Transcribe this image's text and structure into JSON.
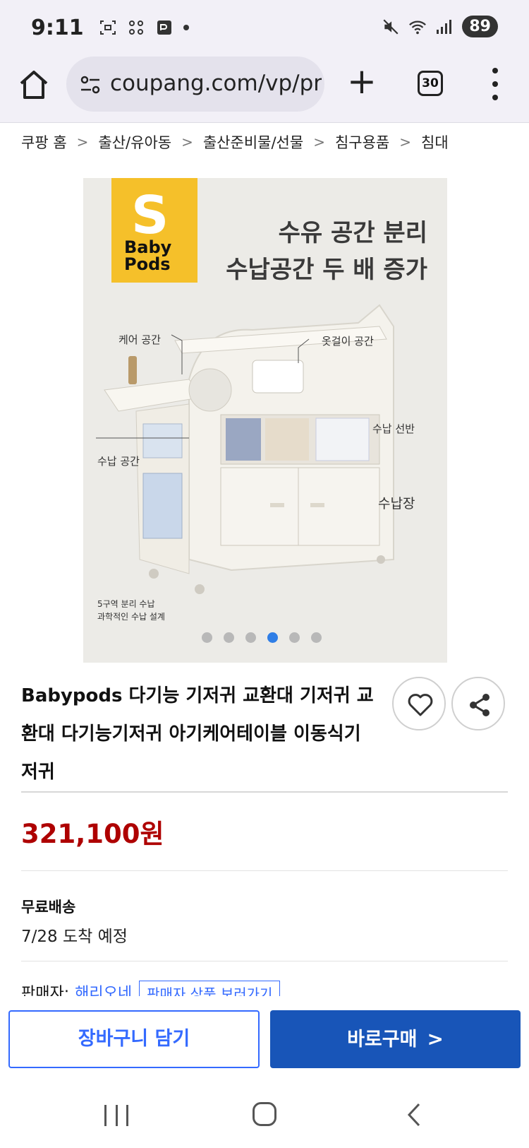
{
  "status_bar": {
    "time": "9:11",
    "battery": "89",
    "icons_left": [
      "screenshot-icon",
      "grid-icon",
      "pay-icon",
      "dot-icon"
    ],
    "icons_right": [
      "mute-icon",
      "wifi-icon",
      "signal-icon",
      "battery-icon"
    ]
  },
  "browser": {
    "url": "coupang.com/vp/pro",
    "tab_count": "30"
  },
  "breadcrumb": [
    "쿠팡 홈",
    "출산/유아동",
    "출산준비물/선물",
    "침구용품",
    "침대"
  ],
  "product_image": {
    "logo_text_1": "Baby",
    "logo_text_2": "Pods",
    "headline_1": "수유 공간 분리",
    "headline_2": "수납공간 두 배 증가",
    "label_care": "케어 공간",
    "label_hanger": "옷걸이 공간",
    "label_shelf": "수납 선반",
    "label_storage": "수납 공간",
    "label_cabinet": "수납장",
    "caption_1": "5구역 분리 수납",
    "caption_2": "과학적인 수납 설계",
    "dot_count": 6,
    "active_dot": 4
  },
  "product": {
    "title": "Babypods 다기능 기저귀 교환대 기저귀 교환대 다기능기저귀 아기케어테이블 이동식기저귀",
    "price": "321,100원",
    "shipping_title": "무료배송",
    "shipping_date": "7/28 도착 예정",
    "seller_label": "판매자:",
    "seller_name": "해리오네",
    "seller_link": "판매자 상품 보러가기"
  },
  "actions": {
    "cart": "장바구니 담기",
    "buy": "바로구매"
  },
  "colors": {
    "price": "#ae0000",
    "accent": "#346aff",
    "buy_button": "#1855b8",
    "logo": "#f5c02a"
  }
}
